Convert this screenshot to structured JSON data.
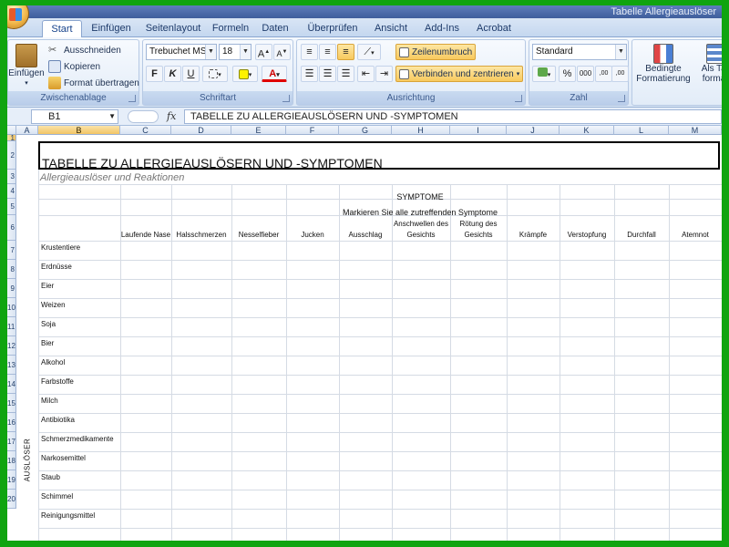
{
  "window": {
    "title": "Tabelle Allergieauslöser"
  },
  "tabs": [
    {
      "label": "Start",
      "name": "tab-start",
      "active": true
    },
    {
      "label": "Einfügen",
      "name": "tab-einfuegen"
    },
    {
      "label": "Seitenlayout",
      "name": "tab-seitenlayout"
    },
    {
      "label": "Formeln",
      "name": "tab-formeln"
    },
    {
      "label": "Daten",
      "name": "tab-daten"
    },
    {
      "label": "Überprüfen",
      "name": "tab-ueberpruefen"
    },
    {
      "label": "Ansicht",
      "name": "tab-ansicht"
    },
    {
      "label": "Add-Ins",
      "name": "tab-add-ins"
    },
    {
      "label": "Acrobat",
      "name": "tab-acrobat"
    }
  ],
  "ribbon": {
    "clipboard": {
      "title": "Zwischenablage",
      "paste": "Einfügen",
      "cut": "Ausschneiden",
      "copy": "Kopieren",
      "format_painter": "Format übertragen"
    },
    "font": {
      "title": "Schriftart",
      "font_name": "Trebuchet MS",
      "font_size": "18",
      "bold": "F",
      "italic": "K",
      "underline": "U",
      "grow": "A",
      "shrink": "A",
      "font_color": "A"
    },
    "alignment": {
      "title": "Ausrichtung",
      "wrap": "Zeilenumbruch",
      "merge": "Verbinden und zentrieren"
    },
    "number": {
      "title": "Zahl",
      "format": "Standard",
      "percent": "%",
      "thousands": "000",
      "inc_decimal": ",00",
      "dec_decimal": ",00"
    },
    "styles": {
      "conditional_line1": "Bedingte",
      "conditional_line2": "Formatierung",
      "table_line1": "Als Tab",
      "table_line2": "formati"
    }
  },
  "formula_bar": {
    "name_box": "B1",
    "fx": "fx",
    "content": "TABELLE ZU ALLERGIEAUSLÖSERN UND -SYMPTOMEN"
  },
  "columns": [
    "A",
    "B",
    "C",
    "D",
    "E",
    "F",
    "G",
    "H",
    "I",
    "J",
    "K",
    "L",
    "M"
  ],
  "rows": [
    "1",
    "2",
    "3",
    "4",
    "5",
    "6",
    "7",
    "8",
    "9",
    "10",
    "11",
    "12",
    "13",
    "14",
    "15",
    "16",
    "17",
    "18",
    "19",
    "20"
  ],
  "sheet": {
    "title": "TABELLE ZU ALLERGIEAUSLÖSERN UND -SYMPTOMEN",
    "subtitle": "Allergieauslöser und Reaktionen",
    "symptoms_header": "SYMPTOME",
    "symptoms_instruction": "Markieren Sie alle zutreffenden Symptome",
    "triggers_label": "AUSLÖSER",
    "symptoms": [
      "Laufende Nase",
      "Halsschmerzen",
      "Nesselfieber",
      "Jucken",
      "Ausschlag",
      "Anschwellen des Gesichts",
      "Rötung des Gesichts",
      "Krämpfe",
      "Verstopfung",
      "Durchfall",
      "Atemnot"
    ],
    "triggers": [
      "Krustentiere",
      "Erdnüsse",
      "Eier",
      "Weizen",
      "Soja",
      "Bier",
      "Alkohol",
      "Farbstoffe",
      "Milch",
      "Antibiotika",
      "Schmerzmedikamente",
      "Narkosemittel",
      "Staub",
      "Schimmel",
      "Reinigungsmittel"
    ]
  },
  "colors": {
    "frame": "#10a410",
    "accent": "#f8c95e",
    "ribbon": "#dbe7f6"
  }
}
